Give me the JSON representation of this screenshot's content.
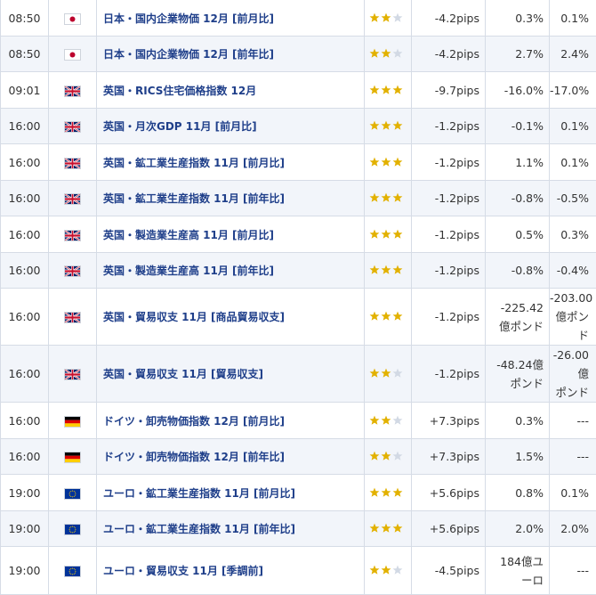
{
  "colors": {
    "star_on": "#e2b100",
    "star_off": "#d2d9e4",
    "event_text": "#1f3f8a",
    "row_alt": "#f2f5fa",
    "border": "#d6dce6"
  },
  "rows": [
    {
      "time": "08:50",
      "flag": "japan-flag-icon",
      "event": "日本・国内企業物価 12月 [前月比]",
      "stars": 2,
      "pips": "-4.2pips",
      "result": "0.3%",
      "previous": "0.1%"
    },
    {
      "time": "08:50",
      "flag": "japan-flag-icon",
      "event": "日本・国内企業物価 12月 [前年比]",
      "stars": 2,
      "pips": "-4.2pips",
      "result": "2.7%",
      "previous": "2.4%"
    },
    {
      "time": "09:01",
      "flag": "uk-flag-icon",
      "event": "英国・RICS住宅価格指数 12月",
      "stars": 3,
      "pips": "-9.7pips",
      "result": "-16.0%",
      "previous": "-17.0%"
    },
    {
      "time": "16:00",
      "flag": "uk-flag-icon",
      "event": "英国・月次GDP 11月 [前月比]",
      "stars": 3,
      "pips": "-1.2pips",
      "result": "-0.1%",
      "previous": "0.1%"
    },
    {
      "time": "16:00",
      "flag": "uk-flag-icon",
      "event": "英国・鉱工業生産指数 11月 [前月比]",
      "stars": 3,
      "pips": "-1.2pips",
      "result": "1.1%",
      "previous": "0.1%"
    },
    {
      "time": "16:00",
      "flag": "uk-flag-icon",
      "event": "英国・鉱工業生産指数 11月 [前年比]",
      "stars": 3,
      "pips": "-1.2pips",
      "result": "-0.8%",
      "previous": "-0.5%"
    },
    {
      "time": "16:00",
      "flag": "uk-flag-icon",
      "event": "英国・製造業生産高 11月 [前月比]",
      "stars": 3,
      "pips": "-1.2pips",
      "result": "0.5%",
      "previous": "0.3%"
    },
    {
      "time": "16:00",
      "flag": "uk-flag-icon",
      "event": "英国・製造業生産高 11月 [前年比]",
      "stars": 3,
      "pips": "-1.2pips",
      "result": "-0.8%",
      "previous": "-0.4%"
    },
    {
      "time": "16:00",
      "flag": "uk-flag-icon",
      "event": "英国・貿易収支 11月 [商品貿易収支]",
      "stars": 3,
      "pips": "-1.2pips",
      "result": "-225.42\n億ポンド",
      "previous": "-203.00\n億ポンド"
    },
    {
      "time": "16:00",
      "flag": "uk-flag-icon",
      "event": "英国・貿易収支 11月 [貿易収支]",
      "stars": 2,
      "pips": "-1.2pips",
      "result": "-48.24億\nポンド",
      "previous": "-26.00億\nポンド"
    },
    {
      "time": "16:00",
      "flag": "germany-flag-icon",
      "event": "ドイツ・卸売物価指数 12月 [前月比]",
      "stars": 2,
      "pips": "+7.3pips",
      "result": "0.3%",
      "previous": "---"
    },
    {
      "time": "16:00",
      "flag": "germany-flag-icon",
      "event": "ドイツ・卸売物価指数 12月 [前年比]",
      "stars": 2,
      "pips": "+7.3pips",
      "result": "1.5%",
      "previous": "---"
    },
    {
      "time": "19:00",
      "flag": "eu-flag-icon",
      "event": "ユーロ・鉱工業生産指数 11月 [前月比]",
      "stars": 3,
      "pips": "+5.6pips",
      "result": "0.8%",
      "previous": "0.1%"
    },
    {
      "time": "19:00",
      "flag": "eu-flag-icon",
      "event": "ユーロ・鉱工業生産指数 11月 [前年比]",
      "stars": 3,
      "pips": "+5.6pips",
      "result": "2.0%",
      "previous": "2.0%"
    },
    {
      "time": "19:00",
      "flag": "eu-flag-icon",
      "event": "ユーロ・貿易収支 11月 [季調前]",
      "stars": 2,
      "pips": "-4.5pips",
      "result": "184億ユ\nーロ",
      "previous": "---"
    }
  ]
}
